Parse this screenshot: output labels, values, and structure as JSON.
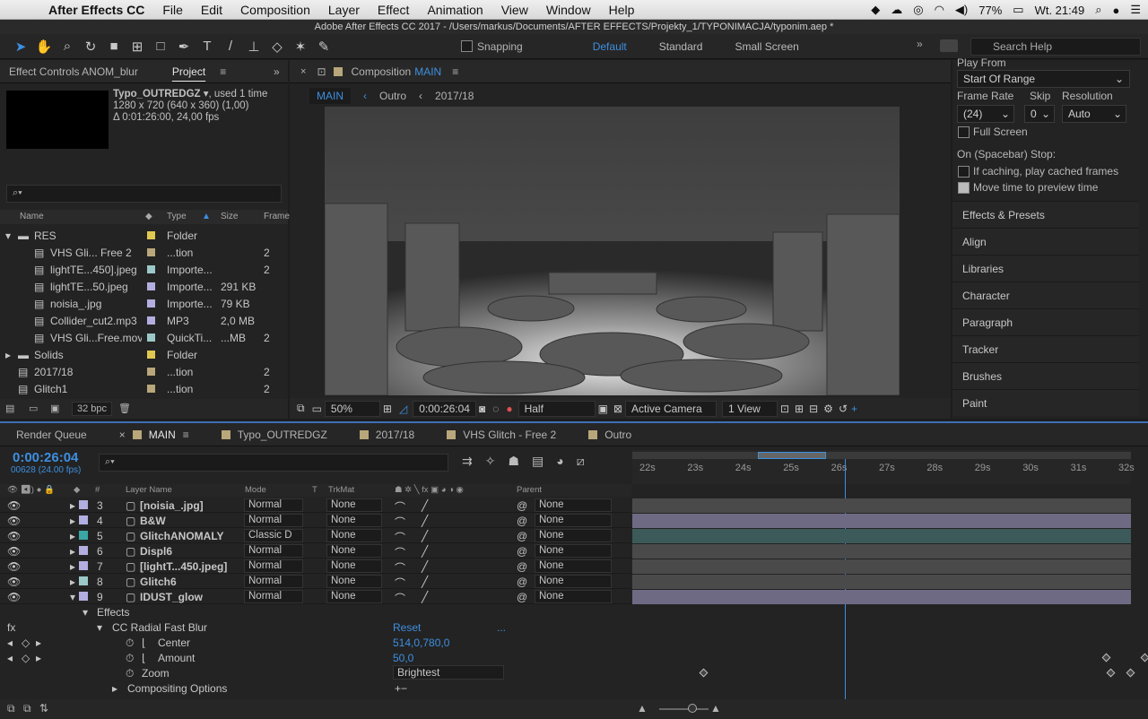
{
  "menubar": {
    "app": "After Effects CC",
    "items": [
      "File",
      "Edit",
      "Composition",
      "Layer",
      "Effect",
      "Animation",
      "View",
      "Window",
      "Help"
    ],
    "battery": "77%",
    "clock": "Wt. 21:49"
  },
  "titlebar": "Adobe After Effects CC 2017 - /Users/markus/Documents/AFTER EFFECTS/Projekty_1/TYPONIMACJA/typonim.aep *",
  "toolbar": {
    "snapping": "Snapping",
    "workspaces": [
      "Default",
      "Standard",
      "Small Screen"
    ],
    "search_placeholder": "Search Help"
  },
  "project": {
    "tabs": [
      "Effect Controls ANOM_blur",
      "Project"
    ],
    "info_name": "Typo_OUTREDGZ",
    "info_used": ", used 1 time",
    "info_line2": "1280 x 720  (640 x 360) (1,00)",
    "info_line3": "Δ 0:01:26:00, 24,00 fps",
    "columns": [
      "Name",
      "Type",
      "Size",
      "Frame"
    ],
    "rows": [
      {
        "name": "RES",
        "type": "Folder",
        "size": "",
        "frame": "",
        "color": "#e0c850",
        "indent": 0,
        "folder": true
      },
      {
        "name": "VHS Gli... Free 2",
        "type": "...tion",
        "size": "",
        "frame": "2",
        "color": "#b8a77a",
        "indent": 1
      },
      {
        "name": "lightTE...450].jpeg",
        "type": "Importe...",
        "size": "",
        "frame": "2",
        "color": "#9bc8c8",
        "indent": 1
      },
      {
        "name": "lightTE...50.jpeg",
        "type": "Importe...",
        "size": "291 KB",
        "frame": "",
        "color": "#b3aee0",
        "indent": 1
      },
      {
        "name": "noisia_.jpg",
        "type": "Importe...",
        "size": "79 KB",
        "frame": "",
        "color": "#b3aee0",
        "indent": 1
      },
      {
        "name": "Collider_cut2.mp3",
        "type": "MP3",
        "size": "2,0 MB",
        "frame": "",
        "color": "#b3aee0",
        "indent": 1
      },
      {
        "name": "VHS Gli...Free.mov",
        "type": "QuickTi...",
        "size": "...MB",
        "frame": "2",
        "color": "#9bc8c8",
        "indent": 1
      },
      {
        "name": "Solids",
        "type": "Folder",
        "size": "",
        "frame": "",
        "color": "#e0c850",
        "indent": 0,
        "folder": true
      },
      {
        "name": "2017/18",
        "type": "...tion",
        "size": "",
        "frame": "2",
        "color": "#b8a77a",
        "indent": 0
      },
      {
        "name": "Glitch1",
        "type": "...tion",
        "size": "",
        "frame": "2",
        "color": "#b8a77a",
        "indent": 0
      }
    ],
    "bpc": "32 bpc"
  },
  "comp": {
    "tab": "Composition",
    "tab_name": "MAIN",
    "crumbs": [
      "MAIN",
      "Outro",
      "2017/18"
    ],
    "zoom": "50%",
    "timecode": "0:00:26:04",
    "resolution": "Half",
    "camera": "Active Camera",
    "views": "1 View"
  },
  "preview": {
    "play_from_label": "Play From",
    "play_from": "Start Of Range",
    "frame_rate_label": "Frame Rate",
    "skip_label": "Skip",
    "resolution_label": "Resolution",
    "frame_rate": "(24)",
    "skip": "0",
    "resolution": "Auto",
    "full_screen": "Full Screen",
    "stop_label": "On (Spacebar) Stop:",
    "cached": "If caching, play cached frames",
    "move_time": "Move time to preview time",
    "sections": [
      "Effects & Presets",
      "Align",
      "Libraries",
      "Character",
      "Paragraph",
      "Tracker",
      "Brushes",
      "Paint"
    ]
  },
  "timeline": {
    "tabs": [
      {
        "label": "Render Queue",
        "color": ""
      },
      {
        "label": "MAIN",
        "color": "#b8a77a"
      },
      {
        "label": "Typo_OUTREDGZ",
        "color": "#b8a77a"
      },
      {
        "label": "2017/18",
        "color": "#b8a77a"
      },
      {
        "label": "VHS Glitch - Free 2",
        "color": "#b8a77a"
      },
      {
        "label": "Outro",
        "color": "#b8a77a"
      }
    ],
    "timecode": "0:00:26:04",
    "frames": "00628 (24.00 fps)",
    "ruler": [
      "22s",
      "23s",
      "24s",
      "25s",
      "26s",
      "27s",
      "28s",
      "29s",
      "30s",
      "31s",
      "32s"
    ],
    "cti": 26.25,
    "headers": {
      "layer": "Layer Name",
      "mode": "Mode",
      "t": "T",
      "trkmat": "TrkMat",
      "parent": "Parent"
    },
    "layers": [
      {
        "num": "3",
        "name": "[noisia_.jpg]",
        "mode": "Normal",
        "trkmat": "None",
        "parent": "None",
        "color": "#b3aee0",
        "bar": "#4a4a4a"
      },
      {
        "num": "4",
        "name": "B&W",
        "mode": "Normal",
        "trkmat": "None",
        "parent": "None",
        "color": "#b3aee0",
        "bar": "#6f6a84"
      },
      {
        "num": "5",
        "name": "GlitchANOMALY",
        "mode": "Classic D",
        "trkmat": "None",
        "parent": "None",
        "color": "#3aa6a6",
        "bar": "#3c5a5a"
      },
      {
        "num": "6",
        "name": "Displ6",
        "mode": "Normal",
        "trkmat": "None",
        "parent": "None",
        "color": "#b3aee0",
        "bar": "#4a4a4a"
      },
      {
        "num": "7",
        "name": "[lightT...450.jpeg]",
        "mode": "Normal",
        "trkmat": "None",
        "parent": "None",
        "color": "#b3aee0",
        "bar": "#4a4a4a"
      },
      {
        "num": "8",
        "name": "Glitch6",
        "mode": "Normal",
        "trkmat": "None",
        "parent": "None",
        "color": "#9bc8c8",
        "bar": "#4a4a4a"
      },
      {
        "num": "9",
        "name": "IDUST_glow",
        "mode": "Normal",
        "trkmat": "None",
        "parent": "None",
        "color": "#b3aee0",
        "bar": "#6f6a84"
      }
    ],
    "effects_label": "Effects",
    "effect_name": "CC Radial Fast Blur",
    "reset": "Reset",
    "more": "...",
    "props": [
      {
        "name": "Center",
        "value": "514,0,780,0"
      },
      {
        "name": "Amount",
        "value": "50,0"
      },
      {
        "name": "Zoom",
        "value": "Brightest"
      }
    ],
    "compositing": "Compositing Options"
  }
}
